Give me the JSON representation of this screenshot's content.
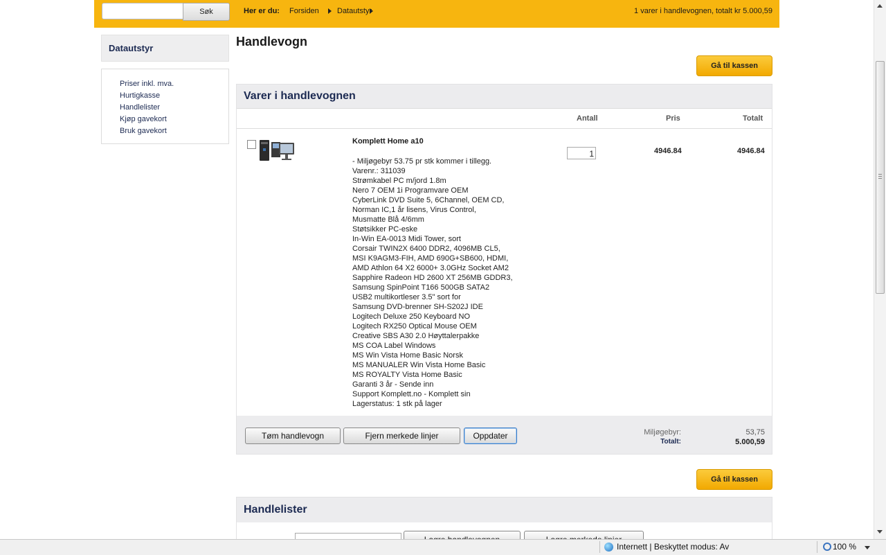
{
  "topbar": {
    "search_placeholder": "",
    "search_button": "Søk",
    "breadcrumb_label": "Her er du:",
    "breadcrumb": [
      "Forsiden",
      "Datautstyr"
    ],
    "cart_summary": "1 varer i handlevognen, totalt kr 5.000,59"
  },
  "sidebar": {
    "heading": "Datautstyr",
    "links": [
      "Priser inkl. mva.",
      "Hurtigkasse",
      "Handlelister",
      "Kjøp gavekort",
      "Bruk gavekort"
    ]
  },
  "main": {
    "title": "Handlevogn",
    "checkout_button": "Gå til kassen",
    "cart_panel_title": "Varer i handlevognen",
    "columns": {
      "quantity": "Antall",
      "price": "Pris",
      "total": "Totalt"
    },
    "item": {
      "name": "Komplett Home a10",
      "description_lines": [
        "- Miljøgebyr 53.75 pr stk kommer i tillegg.",
        "Varenr.: 311039",
        "Strømkabel PC m/jord 1.8m",
        "Nero 7 OEM 1i Programvare OEM",
        "CyberLink DVD Suite 5, 6Channel, OEM CD,",
        "Norman IC,1 år lisens, Virus Control,",
        "Musmatte Blå 4/6mm",
        "Støtsikker PC-eske",
        "In-Win EA-0013 Midi Tower, sort",
        "Corsair TWIN2X 6400 DDR2, 4096MB CL5,",
        "MSI K9AGM3-FIH, AMD 690G+SB600, HDMI,",
        "AMD Athlon 64 X2 6000+ 3.0GHz Socket AM2",
        "Sapphire Radeon HD 2600 XT 256MB GDDR3,",
        "Samsung SpinPoint T166 500GB SATA2",
        "USB2 multikortleser 3.5\" sort for",
        "Samsung DVD-brenner SH-S202J IDE",
        "Logitech Deluxe 250 Keyboard NO",
        "Logitech RX250 Optical Mouse OEM",
        "Creative SBS A30 2.0 Høyttalerpakke",
        "MS COA Label Windows",
        "MS Win Vista Home Basic Norsk",
        "MS MANUALER Win Vista Home Basic",
        "MS ROYALTY Vista Home Basic",
        "Garanti 3 år - Sende inn",
        "Support Komplett.no - Komplett sin",
        "Lagerstatus: 1 stk på lager"
      ],
      "quantity": "1",
      "price": "4946.84",
      "total": "4946.84"
    },
    "actions": {
      "empty_cart": "Tøm handlevogn",
      "remove_selected": "Fjern merkede linjer",
      "update": "Oppdater"
    },
    "fee_label": "Miljøgebyr:",
    "fee_value": "53,75",
    "total_label": "Totalt:",
    "total_value": "5.000,59",
    "lists_panel_title": "Handlelister",
    "save_cart_button": "Lagre handlevognen",
    "save_selected_button": "Lagre merkede linjer"
  },
  "statusbar": {
    "zone_text": "Internett | Beskyttet modus: Av",
    "zoom": "100 %"
  }
}
